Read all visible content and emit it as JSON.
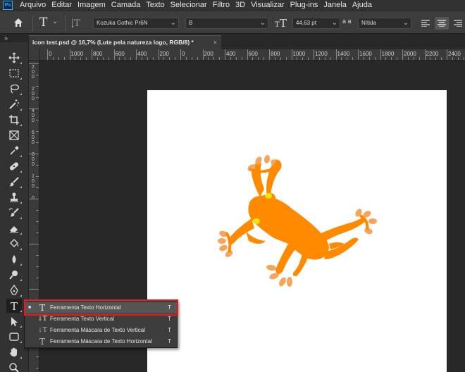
{
  "menubar": {
    "logo": "Ps",
    "items": [
      "Arquivo",
      "Editar",
      "Imagem",
      "Camada",
      "Texto",
      "Selecionar",
      "Filtro",
      "3D",
      "Visualizar",
      "Plug-ins",
      "Janela",
      "Ajuda"
    ]
  },
  "options": {
    "font_family": "Kozuka Gothic Pr6N",
    "font_style": "B",
    "font_size": "44,63 pt",
    "antialias_label": "a a",
    "antialias": "Nítida"
  },
  "tab": {
    "collapse": "»",
    "title": "icon test.psd @ 16,7% (Lute pela natureza logo, RGB/8) *",
    "close": "×"
  },
  "ruler": {
    "top_labels": [
      "0",
      "1000",
      "800",
      "600",
      "400",
      "200",
      "0",
      "200",
      "400",
      "600",
      "800",
      "1000",
      "1200",
      "1400",
      "1600",
      "1800",
      "2000",
      "2200",
      "2400"
    ],
    "left_labels": [
      "2",
      "0",
      "0",
      "2",
      "0",
      "0",
      "4",
      "0",
      "0",
      "6",
      "0",
      "0",
      "8",
      "0",
      "0",
      "1",
      "0",
      "0",
      "0"
    ]
  },
  "flyout": {
    "items": [
      {
        "mark": "■",
        "icon": "T",
        "label": "Ferramenta Texto Horizontal",
        "key": "T"
      },
      {
        "mark": "",
        "icon": "↓T",
        "label": "Ferramenta Texto Vertical",
        "key": "T"
      },
      {
        "mark": "",
        "icon": "⇣T",
        "label": "Ferramenta Máscara de Texto Vertical",
        "key": "T"
      },
      {
        "mark": "",
        "icon": "T",
        "label": "Ferramenta Máscara de Texto Horizontal",
        "key": "T"
      }
    ]
  },
  "colors": {
    "accent": "#31a8ff",
    "highlight": "#e81a1a",
    "frog_orange": "#ff8a00",
    "frog_light": "#f7a55a",
    "frog_eye": "#f2e300"
  },
  "tools": [
    "move-icon",
    "marquee-icon",
    "lasso-icon",
    "magic-wand-icon",
    "crop-icon",
    "frame-icon",
    "eyedropper-icon",
    "healing-brush-icon",
    "brush-icon",
    "clone-stamp-icon",
    "history-brush-icon",
    "eraser-icon",
    "paint-bucket-icon",
    "blur-icon",
    "dodge-icon",
    "pen-icon",
    "type-icon",
    "path-selection-icon",
    "rectangle-icon",
    "hand-icon",
    "zoom-icon"
  ]
}
